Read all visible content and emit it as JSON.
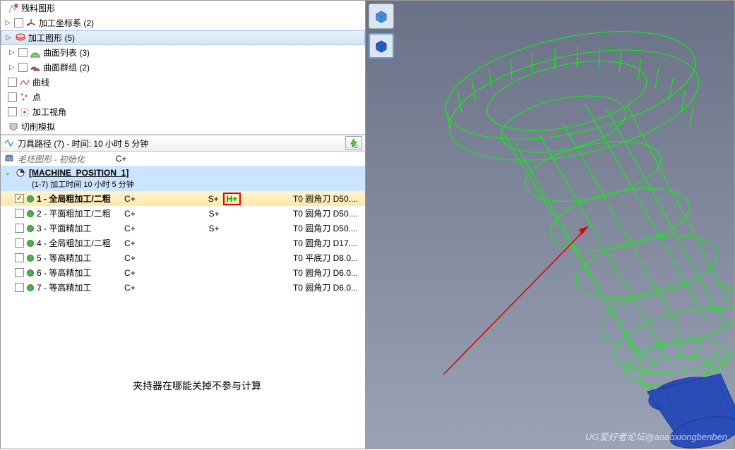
{
  "tree": {
    "residual": "残料图形",
    "wcs": "加工坐标系 (2)",
    "machining_geom": "加工图形 (5)",
    "surface_list": "曲面列表 (3)",
    "surface_group": "曲面群组 (2)",
    "curves": "曲线",
    "points": "点",
    "machining_view": "加工视角",
    "cutting_sim": "切削模拟"
  },
  "toolpath_header": "刀具路径 (7) - 时间: 10 小时 5 分钟",
  "stock": {
    "label": "毛坯图形",
    "sep": " - ",
    "init": "初始化",
    "cplus": "C+"
  },
  "machine_pos": {
    "title": "[MACHINE_POSITION_1]",
    "subtitle": "(1-7) 加工时间 10 小时 5 分钟"
  },
  "ops": [
    {
      "num": "1",
      "name": "全局粗加工/二粗",
      "c": "C+",
      "s": "S+",
      "h": "H+",
      "tool": "T0 圆角刀 D50...."
    },
    {
      "num": "2",
      "name": "平面粗加工/二粗",
      "c": "C+",
      "s": "S+",
      "h": "",
      "tool": "T0 圆角刀 D50...."
    },
    {
      "num": "3",
      "name": "平面精加工",
      "c": "C+",
      "s": "S+",
      "h": "",
      "tool": "T0 圆角刀 D50...."
    },
    {
      "num": "4",
      "name": "全局粗加工/二粗",
      "c": "C+",
      "s": "",
      "h": "",
      "tool": "T0 圆角刀 D17...."
    },
    {
      "num": "5",
      "name": "等高精加工",
      "c": "C+",
      "s": "",
      "h": "",
      "tool": "T0 平底刀 D8.0..."
    },
    {
      "num": "6",
      "name": "等高精加工",
      "c": "C+",
      "s": "",
      "h": "",
      "tool": "T0 圆角刀 D6.0..."
    },
    {
      "num": "7",
      "name": "等高精加工",
      "c": "C+",
      "s": "",
      "h": "",
      "tool": "T0 圆角刀 D6.0..."
    }
  ],
  "annotation_text": "夹持器在哪能关掉不参与计算",
  "watermark": "UG爱好者论坛@aoaoxiongbenben"
}
